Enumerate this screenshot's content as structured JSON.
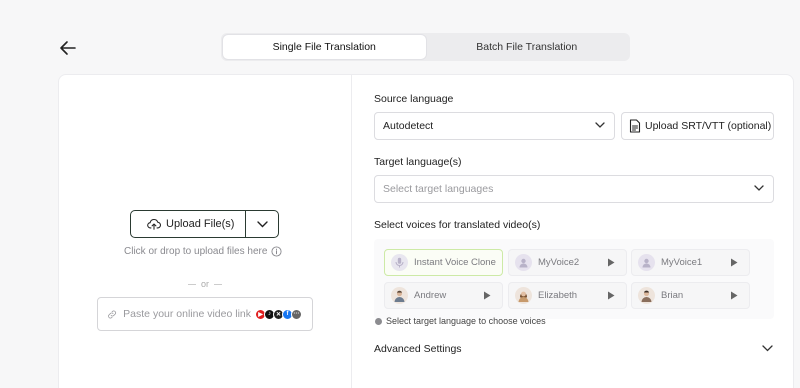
{
  "tabs": [
    {
      "label": "Single File Translation",
      "active": true
    },
    {
      "label": "Batch File Translation",
      "active": false
    }
  ],
  "upload": {
    "button_label": "Upload File(s)",
    "drop_hint": "Click or drop to upload files here",
    "or_text": "or",
    "paste_placeholder": "Paste your online video link",
    "platform_icons": [
      "youtube-icon",
      "tiktok-icon",
      "x-icon",
      "facebook-icon",
      "more-icon"
    ]
  },
  "source_language": {
    "label": "Source language",
    "value": "Autodetect",
    "upload_srt_label": "Upload SRT/VTT (optional)"
  },
  "target_language": {
    "label": "Target language(s)",
    "placeholder": "Select target languages"
  },
  "voices": {
    "label": "Select voices for translated video(s)",
    "items": [
      {
        "name": "Instant Voice Clone",
        "icon": "mic-icon",
        "selected": true
      },
      {
        "name": "MyVoice2",
        "icon": "voice-avatar-icon",
        "selected": false
      },
      {
        "name": "MyVoice1",
        "icon": "voice-avatar-icon",
        "selected": false
      },
      {
        "name": "Andrew",
        "icon": "person-avatar",
        "selected": false
      },
      {
        "name": "Elizabeth",
        "icon": "person-avatar",
        "selected": false
      },
      {
        "name": "Brian",
        "icon": "person-avatar",
        "selected": false
      }
    ],
    "note": "Select target language to choose voices"
  },
  "advanced": {
    "label": "Advanced Settings"
  },
  "colors": {
    "accent": "#2a3a31",
    "selected_border": "#cdeaa6",
    "card_bg": "#ffffff",
    "page_bg": "#f7f7f8"
  }
}
